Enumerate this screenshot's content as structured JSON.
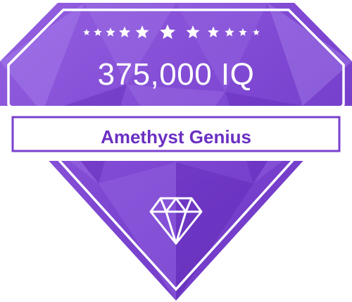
{
  "badge": {
    "value": "375,000 IQ",
    "title": "Amethyst Genius",
    "stars_count": 11,
    "gem_icon": "diamond-icon",
    "star_icon": "star-icon"
  },
  "colors": {
    "gem_dark": "#6a2fc2",
    "gem_mid": "#8a55d8",
    "gem_light": "#a67be6",
    "outline": "#7b41cf",
    "text_white": "#ffffff",
    "title_purple": "#6a2fc2"
  }
}
